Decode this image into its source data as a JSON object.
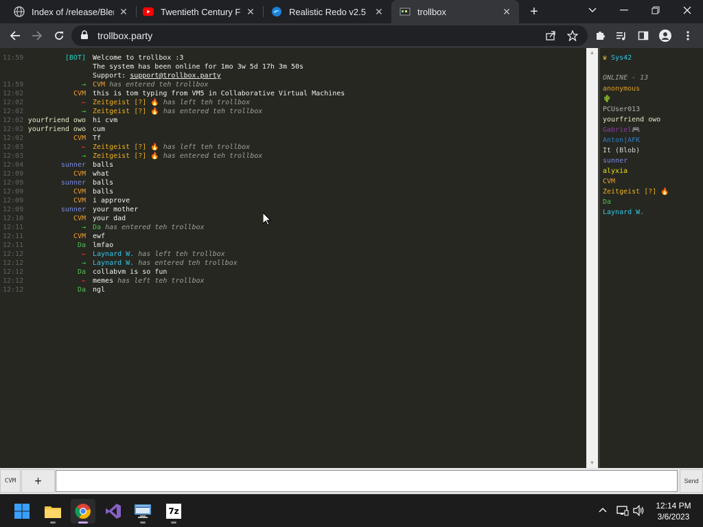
{
  "tabs": [
    {
      "title": "Index of /release/Blende",
      "icon": "globe-icon"
    },
    {
      "title": "Twentieth Century Fox",
      "icon": "youtube-icon"
    },
    {
      "title": "Realistic Redo v2.5",
      "icon": "edge-like-icon"
    },
    {
      "title": "trollbox",
      "icon": "trollbox-icon",
      "active": true
    }
  ],
  "address": {
    "url": "trollbox.party"
  },
  "chat": {
    "messages": [
      {
        "time": "11:59",
        "nick": "[BOT]",
        "nick_color": "#22d3c5",
        "text": "Welcome to trollbox :3",
        "kind": "msg"
      },
      {
        "time": "",
        "nick": "",
        "nick_color": "#22d3c5",
        "text": "The system has been online for 1mo 3w 5d 17h 3m 50s",
        "kind": "msg"
      },
      {
        "time": "",
        "nick": "",
        "nick_color": "#22d3c5",
        "text": "Support: ",
        "link": "support@trollbox.party",
        "kind": "link"
      },
      {
        "time": "11:59",
        "nick": "→",
        "nick_color": "#3ddc3d",
        "event_nick": "CVM",
        "event_color": "#f0a030",
        "text": " has entered teh trollbox",
        "kind": "event"
      },
      {
        "time": "12:02",
        "nick": "CVM",
        "nick_color": "#f0a030",
        "text": "this is tom typing from VM5 in Collaborative Virtual Machines",
        "kind": "msg"
      },
      {
        "time": "12:02",
        "nick": "←",
        "nick_color": "#e03030",
        "event_nick": "Zeitgeist [?] 🔥",
        "event_color": "#f0b020",
        "text": " has left teh trollbox",
        "kind": "event"
      },
      {
        "time": "12:02",
        "nick": "→",
        "nick_color": "#3ddc3d",
        "event_nick": "Zeitgeist [?] 🔥",
        "event_color": "#f0b020",
        "text": " has entered teh trollbox",
        "kind": "event"
      },
      {
        "time": "12:02",
        "nick": "yourfriend owo",
        "nick_color": "#e9e9c6",
        "text": "hi cvm",
        "kind": "msg"
      },
      {
        "time": "12:02",
        "nick": "yourfriend owo",
        "nick_color": "#e9e9c6",
        "text": "cum",
        "kind": "msg"
      },
      {
        "time": "12:02",
        "nick": "CVM",
        "nick_color": "#f0a030",
        "text": "Tf",
        "kind": "msg"
      },
      {
        "time": "12:03",
        "nick": "←",
        "nick_color": "#e03030",
        "event_nick": "Zeitgeist [?] 🔥",
        "event_color": "#f0b020",
        "text": " has left teh trollbox",
        "kind": "event"
      },
      {
        "time": "12:03",
        "nick": "→",
        "nick_color": "#3ddc3d",
        "event_nick": "Zeitgeist [?] 🔥",
        "event_color": "#f0b020",
        "text": " has entered teh trollbox",
        "kind": "event"
      },
      {
        "time": "12:04",
        "nick": "sunner",
        "nick_color": "#7a8ae0",
        "text": "balls",
        "kind": "msg"
      },
      {
        "time": "12:09",
        "nick": "CVM",
        "nick_color": "#f0a030",
        "text": "what",
        "kind": "msg"
      },
      {
        "time": "12:09",
        "nick": "sunner",
        "nick_color": "#7a8ae0",
        "text": "balls",
        "kind": "msg"
      },
      {
        "time": "12:09",
        "nick": "CVM",
        "nick_color": "#f0a030",
        "text": "balls",
        "kind": "msg"
      },
      {
        "time": "12:09",
        "nick": "CVM",
        "nick_color": "#f0a030",
        "text": "i approve",
        "kind": "msg"
      },
      {
        "time": "12:09",
        "nick": "sunner",
        "nick_color": "#7a8ae0",
        "text": "your mother",
        "kind": "msg"
      },
      {
        "time": "12:10",
        "nick": "CVM",
        "nick_color": "#f0a030",
        "text": "your dad",
        "kind": "msg"
      },
      {
        "time": "12:11",
        "nick": "→",
        "nick_color": "#3ddc3d",
        "event_nick": "Da",
        "event_color": "#50c050",
        "text": " has entered teh trollbox",
        "kind": "event"
      },
      {
        "time": "12:11",
        "nick": "CVM",
        "nick_color": "#f0a030",
        "text": "ewf",
        "kind": "msg"
      },
      {
        "time": "12:11",
        "nick": "Da",
        "nick_color": "#50c050",
        "text": "lmfao",
        "kind": "msg"
      },
      {
        "time": "12:12",
        "nick": "←",
        "nick_color": "#e03030",
        "event_nick": "Laynard W.",
        "event_color": "#33c6e8",
        "text": " has left teh trollbox",
        "kind": "event"
      },
      {
        "time": "12:12",
        "nick": "→",
        "nick_color": "#3ddc3d",
        "event_nick": "Laynard W.",
        "event_color": "#33c6e8",
        "text": " has entered teh trollbox",
        "kind": "event"
      },
      {
        "time": "12:12",
        "nick": "Da",
        "nick_color": "#50c050",
        "text": "collabvm is so fun",
        "kind": "msg"
      },
      {
        "time": "12:12",
        "nick": "←",
        "nick_color": "#e03030",
        "event_nick": "memes",
        "event_color": "#f1f1f1",
        "text": " has left teh trollbox",
        "kind": "event"
      },
      {
        "time": "12:12",
        "nick": "Da",
        "nick_color": "#50c050",
        "text": "ngl",
        "kind": "msg"
      }
    ]
  },
  "users_panel": {
    "self": {
      "crown": "♛",
      "name": "Sys42",
      "color": "#33c6e8"
    },
    "online_header": "ONLINE - 13",
    "users": [
      {
        "name": "anonymous",
        "color": "#e0a020"
      },
      {
        "name": "🌵",
        "color": "#60a060"
      },
      {
        "name": "PCUser013",
        "color": "#b0b0b0"
      },
      {
        "name": "yourfriend owo",
        "color": "#e9e9c6"
      },
      {
        "name": "Gabriel🎮",
        "color": "#8a3aa0"
      },
      {
        "name": "Anton|AFK",
        "color": "#2e7ec8"
      },
      {
        "name": "It (Blob)",
        "color": "#d8d8d8"
      },
      {
        "name": "sunner",
        "color": "#7a8ae0"
      },
      {
        "name": "alyxia",
        "color": "#e8e020"
      },
      {
        "name": "CVM",
        "color": "#f0a030"
      },
      {
        "name": "Zeitgeist [?] 🔥",
        "color": "#f0b020"
      },
      {
        "name": "Da",
        "color": "#50c050"
      },
      {
        "name": "Laynard W.",
        "color": "#33c6e8"
      }
    ]
  },
  "input": {
    "nick_label": "CVM",
    "plus_label": "+",
    "value": "",
    "send_label": "Send"
  },
  "taskbar": {
    "apps": [
      "windows-start-icon",
      "file-explorer-icon",
      "chrome-icon",
      "visual-studio-icon",
      "remote-desktop-icon",
      "7zip-icon"
    ],
    "seven_zip_label": "7z",
    "time": "12:14 PM",
    "date": "3/6/2023"
  }
}
